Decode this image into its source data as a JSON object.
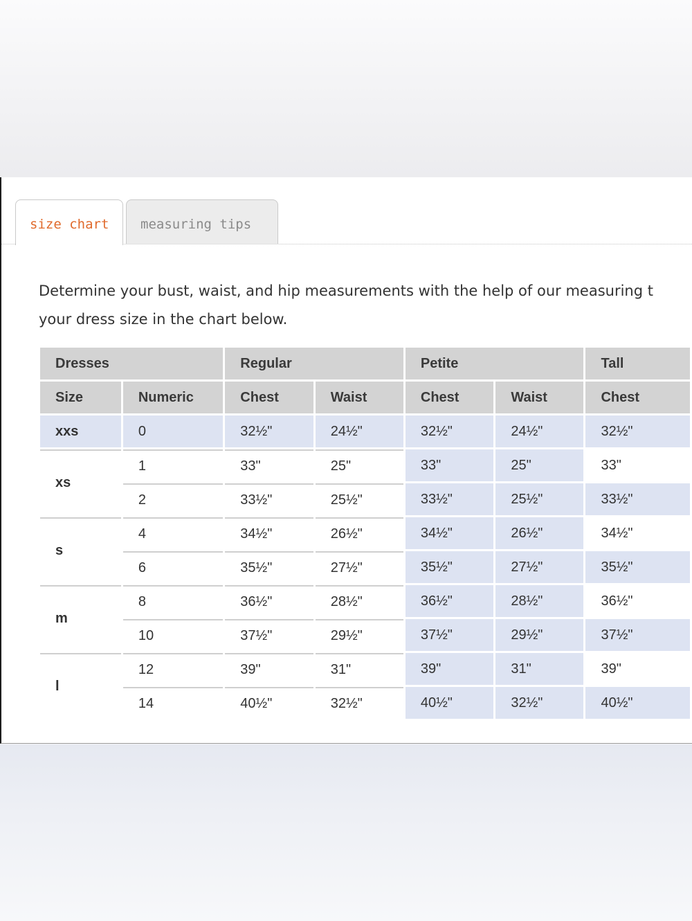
{
  "tabs": [
    {
      "label": "size chart",
      "active": true
    },
    {
      "label": "measuring tips",
      "active": false
    }
  ],
  "intro": {
    "line1": "Determine your bust, waist, and hip measurements with the help of our measuring t",
    "line2": "your dress size in the chart below."
  },
  "table": {
    "group_header": {
      "dresses": "Dresses",
      "regular": "Regular",
      "petite": "Petite",
      "tall": "Tall"
    },
    "columns": {
      "size": "Size",
      "numeric": "Numeric",
      "reg_chest": "Chest",
      "reg_waist": "Waist",
      "pet_chest": "Chest",
      "pet_waist": "Waist",
      "tall_chest": "Chest"
    },
    "groups": [
      {
        "size": "xxs",
        "rows": [
          {
            "numeric": "0",
            "reg_chest": "32½\"",
            "reg_waist": "24½\"",
            "pet_chest": "32½\"",
            "pet_waist": "24½\"",
            "tall_chest": "32½\""
          }
        ]
      },
      {
        "size": "xs",
        "rows": [
          {
            "numeric": "1",
            "reg_chest": "33\"",
            "reg_waist": "25\"",
            "pet_chest": "33\"",
            "pet_waist": "25\"",
            "tall_chest": "33\""
          },
          {
            "numeric": "2",
            "reg_chest": "33½\"",
            "reg_waist": "25½\"",
            "pet_chest": "33½\"",
            "pet_waist": "25½\"",
            "tall_chest": "33½\""
          }
        ]
      },
      {
        "size": "s",
        "rows": [
          {
            "numeric": "4",
            "reg_chest": "34½\"",
            "reg_waist": "26½\"",
            "pet_chest": "34½\"",
            "pet_waist": "26½\"",
            "tall_chest": "34½\""
          },
          {
            "numeric": "6",
            "reg_chest": "35½\"",
            "reg_waist": "27½\"",
            "pet_chest": "35½\"",
            "pet_waist": "27½\"",
            "tall_chest": "35½\""
          }
        ]
      },
      {
        "size": "m",
        "rows": [
          {
            "numeric": "8",
            "reg_chest": "36½\"",
            "reg_waist": "28½\"",
            "pet_chest": "36½\"",
            "pet_waist": "28½\"",
            "tall_chest": "36½\""
          },
          {
            "numeric": "10",
            "reg_chest": "37½\"",
            "reg_waist": "29½\"",
            "pet_chest": "37½\"",
            "pet_waist": "29½\"",
            "tall_chest": "37½\""
          }
        ]
      },
      {
        "size": "l",
        "rows": [
          {
            "numeric": "12",
            "reg_chest": "39\"",
            "reg_waist": "31\"",
            "pet_chest": "39\"",
            "pet_waist": "31\"",
            "tall_chest": "39\""
          },
          {
            "numeric": "14",
            "reg_chest": "40½\"",
            "reg_waist": "32½\"",
            "pet_chest": "40½\"",
            "pet_waist": "32½\"",
            "tall_chest": "40½\""
          }
        ]
      }
    ]
  },
  "colors": {
    "accent": "#e06a2c",
    "header_gray": "#d3d3d3",
    "highlight_blue": "#dde3f2"
  }
}
